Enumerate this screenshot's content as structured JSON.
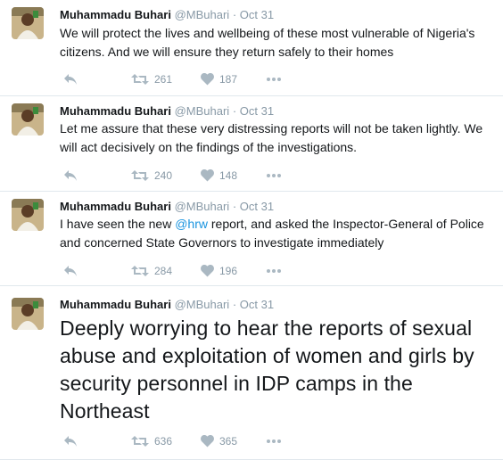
{
  "tweets": [
    {
      "name": "Muhammadu Buhari",
      "handle": "@MBuhari",
      "separator": "·",
      "time": "Oct 31",
      "text": "We will protect the lives and wellbeing of these most vulnerable of Nigeria's citizens. And we will ensure they return safely to their homes",
      "retweets": "261",
      "likes": "187"
    },
    {
      "name": "Muhammadu Buhari",
      "handle": "@MBuhari",
      "separator": "·",
      "time": "Oct 31",
      "text": "Let me assure that these very distressing reports will not be taken lightly. We will act decisively on the findings of the investigations.",
      "retweets": "240",
      "likes": "148"
    },
    {
      "name": "Muhammadu Buhari",
      "handle": "@MBuhari",
      "separator": "·",
      "time": "Oct 31",
      "text_pre": "I have seen the new ",
      "mention": "@hrw",
      "text_post": " report, and asked the Inspector-General of Police and concerned State Governors to investigate immediately",
      "retweets": "284",
      "likes": "196"
    },
    {
      "name": "Muhammadu Buhari",
      "handle": "@MBuhari",
      "separator": "·",
      "time": "Oct 31",
      "text": "Deeply worrying to hear the reports of sexual abuse and exploitation of women and girls by security personnel in IDP camps in the Northeast",
      "retweets": "636",
      "likes": "365"
    }
  ],
  "icons": {
    "reply": "reply-icon",
    "retweet": "retweet-icon",
    "like": "heart-icon",
    "more": "more-icon",
    "avatar": "avatar"
  },
  "colors": {
    "icon_gray": "#aab8c2",
    "meta_gray": "#8899a6",
    "link_blue": "#1b95e0",
    "divider": "#e1e8ed"
  }
}
